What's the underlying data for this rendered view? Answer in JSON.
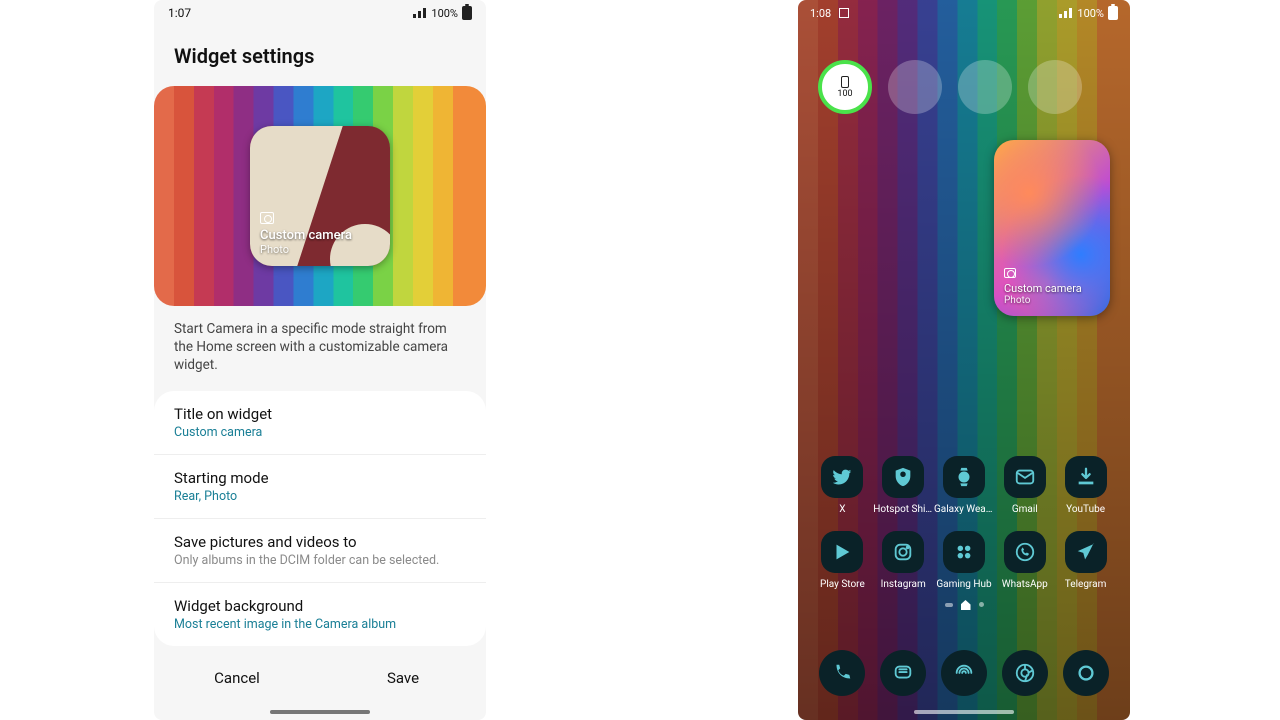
{
  "left_phone": {
    "status": {
      "time": "1:07",
      "battery_pct": "100%"
    },
    "page_title": "Widget settings",
    "widget_preview": {
      "icon": "camera-icon",
      "title": "Custom camera",
      "subtitle": "Photo"
    },
    "description": "Start Camera in a specific mode straight from the Home screen with a customizable camera widget.",
    "settings": [
      {
        "label": "Title on widget",
        "value": "Custom camera",
        "value_style": "accent"
      },
      {
        "label": "Starting mode",
        "value": "Rear, Photo",
        "value_style": "accent"
      },
      {
        "label": "Save pictures and videos to",
        "value": "Only albums in the DCIM folder can be selected.",
        "value_style": "muted"
      },
      {
        "label": "Widget background",
        "value": "Most recent image in the Camera album",
        "value_style": "accent"
      }
    ],
    "buttons": {
      "cancel": "Cancel",
      "save": "Save"
    }
  },
  "right_phone": {
    "status": {
      "time": "1:08",
      "battery_pct": "100%"
    },
    "battery_widget_value": "100",
    "placeholder_circles": 3,
    "home_widget": {
      "icon": "camera-icon",
      "title": "Custom camera",
      "subtitle": "Photo"
    },
    "app_rows": [
      [
        {
          "label": "X",
          "icon": "x-bird-icon"
        },
        {
          "label": "Hotspot Shield...",
          "icon": "shield-icon"
        },
        {
          "label": "Galaxy Weara...",
          "icon": "watch-icon"
        },
        {
          "label": "Gmail",
          "icon": "mail-icon"
        },
        {
          "label": "YouTube",
          "icon": "download-icon"
        }
      ],
      [
        {
          "label": "Play Store",
          "icon": "play-icon"
        },
        {
          "label": "Instagram",
          "icon": "camera-app-icon"
        },
        {
          "label": "Gaming Hub",
          "icon": "grid4-icon"
        },
        {
          "label": "WhatsApp",
          "icon": "phone-bubble-icon"
        },
        {
          "label": "Telegram",
          "icon": "send-icon"
        }
      ]
    ],
    "dock": [
      {
        "icon": "phone-icon"
      },
      {
        "icon": "messages-icon"
      },
      {
        "icon": "radar-icon"
      },
      {
        "icon": "chrome-icon"
      },
      {
        "icon": "circle-icon"
      }
    ]
  }
}
